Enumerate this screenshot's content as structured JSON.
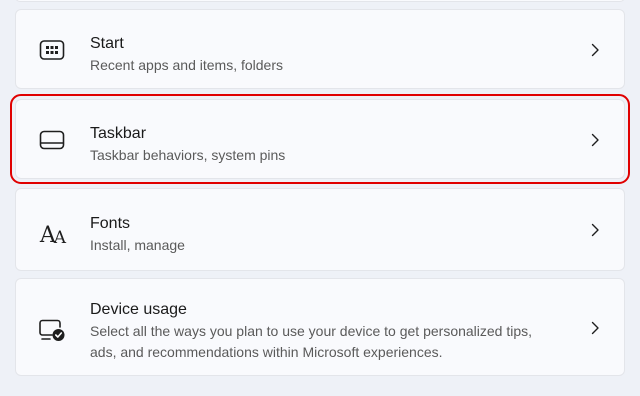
{
  "settings_list": {
    "items": [
      {
        "id": "start",
        "icon": "start-menu-icon",
        "title": "Start",
        "subtitle": "Recent apps and items, folders"
      },
      {
        "id": "taskbar",
        "icon": "taskbar-icon",
        "title": "Taskbar",
        "subtitle": "Taskbar behaviors, system pins",
        "highlighted": true
      },
      {
        "id": "fonts",
        "icon": "fonts-icon",
        "icon_glyph_large": "A",
        "icon_glyph_small": "A",
        "title": "Fonts",
        "subtitle": "Install, manage"
      },
      {
        "id": "device-usage",
        "icon": "device-usage-icon",
        "title": "Device usage",
        "subtitle": "Select all the ways you plan to use your device to get personalized tips, ads, and recommendations within Microsoft experiences."
      }
    ]
  },
  "colors": {
    "page_background": "#eef1f7",
    "card_background": "#f9fafd",
    "card_border": "#e3e5ea",
    "highlight_outline": "#e00000",
    "primary_text": "#1a1a1a",
    "secondary_text": "#5a5a5a"
  }
}
